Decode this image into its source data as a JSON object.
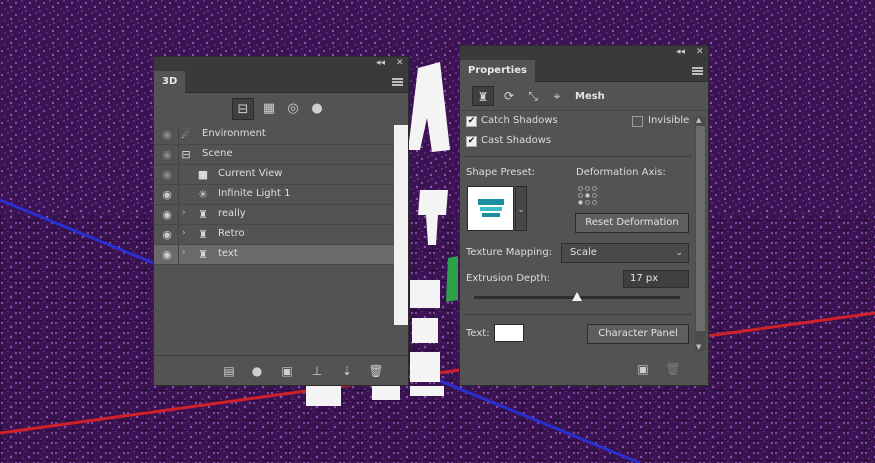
{
  "colors": {
    "background": "#3b1252",
    "panel_bg": "#535353",
    "axis_red": "#d0202a",
    "axis_blue": "#2a2fd0",
    "grid_purple": "#7a3aa0"
  },
  "panel_3d": {
    "title": "3D",
    "filter_icons": [
      "scene-filter-icon",
      "mesh-filter-icon",
      "material-filter-icon",
      "light-filter-icon"
    ],
    "layers": [
      {
        "name": "Environment",
        "icon": "environment-icon",
        "visible_dim": true
      },
      {
        "name": "Scene",
        "icon": "scene-icon",
        "visible_dim": true
      },
      {
        "name": "Current View",
        "icon": "camera-icon",
        "visible_dim": true
      },
      {
        "name": "Infinite Light 1",
        "icon": "light-icon",
        "visible_dim": false
      },
      {
        "name": "really",
        "icon": "mesh-icon",
        "expandable": true
      },
      {
        "name": "Retro",
        "icon": "mesh-icon",
        "expandable": true
      },
      {
        "name": "text",
        "icon": "mesh-icon",
        "expandable": true,
        "selected": true
      }
    ],
    "bottom_icons": [
      "new-mesh-icon",
      "new-light-icon",
      "render-icon",
      "ground-icon",
      "drop-to-plane-icon",
      "trash-icon"
    ]
  },
  "properties": {
    "title": "Properties",
    "tab_label": "Mesh",
    "catch_shadows": {
      "label": "Catch Shadows",
      "checked": true
    },
    "invisible": {
      "label": "Invisible",
      "checked": false
    },
    "cast_shadows": {
      "label": "Cast Shadows",
      "checked": true
    },
    "shape_preset_label": "Shape Preset:",
    "deformation_axis_label": "Deformation Axis:",
    "reset_deformation_label": "Reset Deformation",
    "texture_mapping_label": "Texture Mapping:",
    "texture_mapping_value": "Scale",
    "extrusion_depth_label": "Extrusion Depth:",
    "extrusion_depth_value": "17 px",
    "extrusion_slider_fraction": 0.5,
    "text_label": "Text:",
    "text_color": "#ffffff",
    "character_panel_label": "Character Panel"
  }
}
